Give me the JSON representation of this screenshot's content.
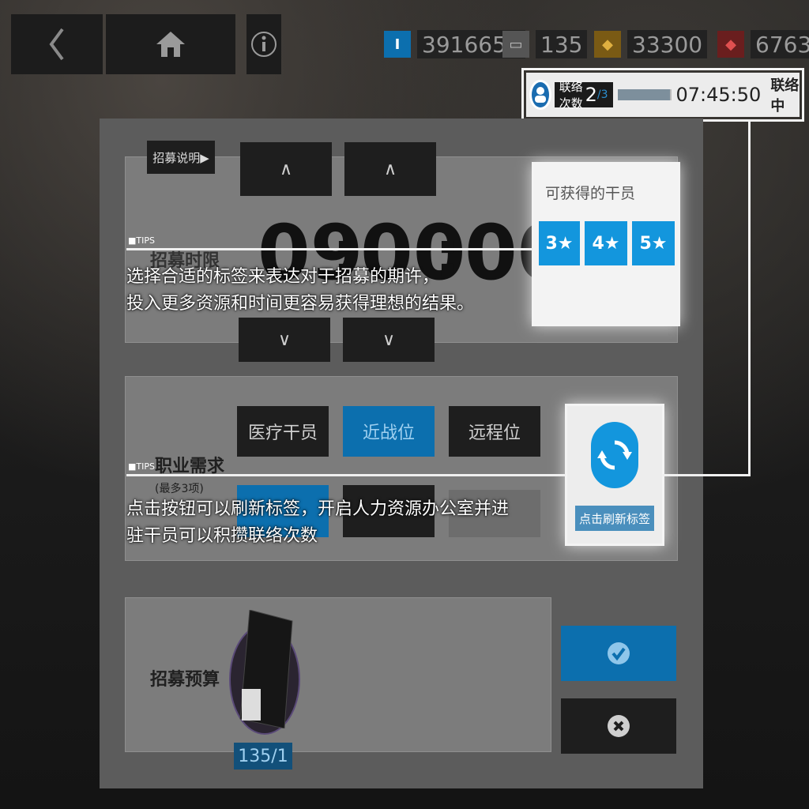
{
  "topbar": {
    "resources": [
      {
        "icon": "orundum-icon",
        "icon_glyph": "I",
        "value": "3916653"
      },
      {
        "icon": "recruit-permit-icon",
        "icon_glyph": "▭",
        "value": "135"
      },
      {
        "icon": "lmd-icon",
        "icon_glyph": "◆",
        "value": "33300"
      },
      {
        "icon": "originite-icon",
        "icon_glyph": "◆",
        "value": "6763"
      }
    ]
  },
  "contact": {
    "label": "联络次数",
    "count": "2",
    "max": "/3",
    "progress": 0.98,
    "timer": "07:45:50",
    "status": "联络中"
  },
  "recruit": {
    "explain_button": "招募说明▶",
    "time_label": "招募时限",
    "hours": "09",
    "colon": ":",
    "minutes": "00",
    "seconds": "00",
    "up_arrow": "∧",
    "down_arrow": "∨",
    "operators_title": "可获得的干员",
    "stars": [
      "3★",
      "4★",
      "5★"
    ],
    "req_label": "职业需求",
    "req_sub": "(最多3项)",
    "tags": [
      "医疗干员",
      "近战位",
      "远程位"
    ],
    "refresh_label": "点击刷新标签",
    "budget_label": "招募预算",
    "budget_value": "135/1"
  },
  "tips": [
    {
      "tag": "■TIPS",
      "text": "选择合适的标签来表达对于招募的期许，\n投入更多资源和时间更容易获得理想的结果。"
    },
    {
      "tag": "■TIPS",
      "text": "点击按钮可以刷新标签，开启人力资源办公室并进\n驻干员可以积攒联络次数"
    }
  ],
  "colors": {
    "accent": "#1396dd",
    "highlight": "#ffffff"
  }
}
